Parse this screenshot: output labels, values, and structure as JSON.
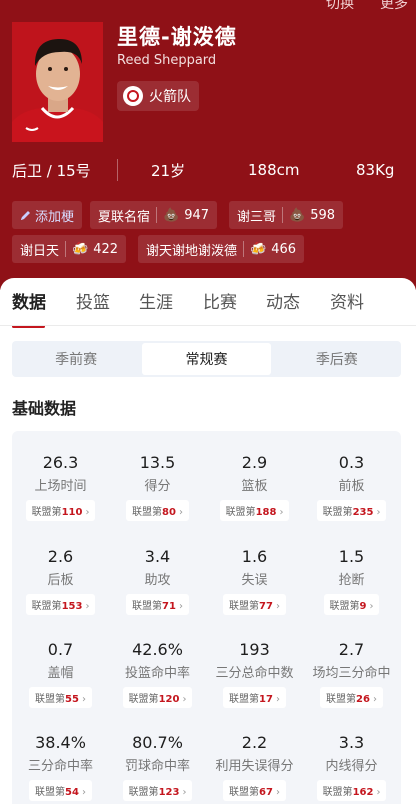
{
  "header": {
    "top_actions": [
      "切换",
      "更多"
    ],
    "name_cn": "里德-谢泼德",
    "name_en": "Reed Sheppard",
    "team": "火箭队",
    "position": "后卫 / 15号",
    "age": "21岁",
    "height": "188cm",
    "weight": "83Kg",
    "tags": [
      {
        "label": "添加梗",
        "icon": "pencil-icon"
      },
      {
        "label": "夏联名宿",
        "emoji": "💩",
        "count": "947"
      },
      {
        "label": "谢三哥",
        "emoji": "💩",
        "count": "598"
      },
      {
        "label": "谢日天",
        "emoji": "🍻",
        "count": "422"
      },
      {
        "label": "谢天谢地谢泼德",
        "emoji": "🍻",
        "count": "466"
      }
    ]
  },
  "tabs": [
    "数据",
    "投篮",
    "生涯",
    "比赛",
    "动态",
    "资料"
  ],
  "active_tab": "数据",
  "segments": [
    "季前赛",
    "常规赛",
    "季后赛"
  ],
  "active_segment": "常规赛",
  "section_title": "基础数据",
  "rank_prefix": "联盟第",
  "stats": [
    {
      "value": "26.3",
      "label": "上场时间",
      "rank": "110"
    },
    {
      "value": "13.5",
      "label": "得分",
      "rank": "80"
    },
    {
      "value": "2.9",
      "label": "篮板",
      "rank": "188"
    },
    {
      "value": "0.3",
      "label": "前板",
      "rank": "235"
    },
    {
      "value": "2.6",
      "label": "后板",
      "rank": "153"
    },
    {
      "value": "3.4",
      "label": "助攻",
      "rank": "71"
    },
    {
      "value": "1.6",
      "label": "失误",
      "rank": "77"
    },
    {
      "value": "1.5",
      "label": "抢断",
      "rank": "9"
    },
    {
      "value": "0.7",
      "label": "盖帽",
      "rank": "55"
    },
    {
      "value": "42.6%",
      "label": "投篮命中率",
      "rank": "120"
    },
    {
      "value": "193",
      "label": "三分总命中数",
      "rank": "17"
    },
    {
      "value": "2.7",
      "label": "场均三分命中",
      "rank": "26"
    },
    {
      "value": "38.4%",
      "label": "三分命中率",
      "rank": "54"
    },
    {
      "value": "80.7%",
      "label": "罚球命中率",
      "rank": "123"
    },
    {
      "value": "2.2",
      "label": "利用失误得分",
      "rank": "67"
    },
    {
      "value": "3.3",
      "label": "内线得分",
      "rank": "162"
    }
  ],
  "colors": {
    "brand_red": "#8f1117",
    "accent_red": "#c4161e",
    "card_bg": "#f3f5f9"
  }
}
